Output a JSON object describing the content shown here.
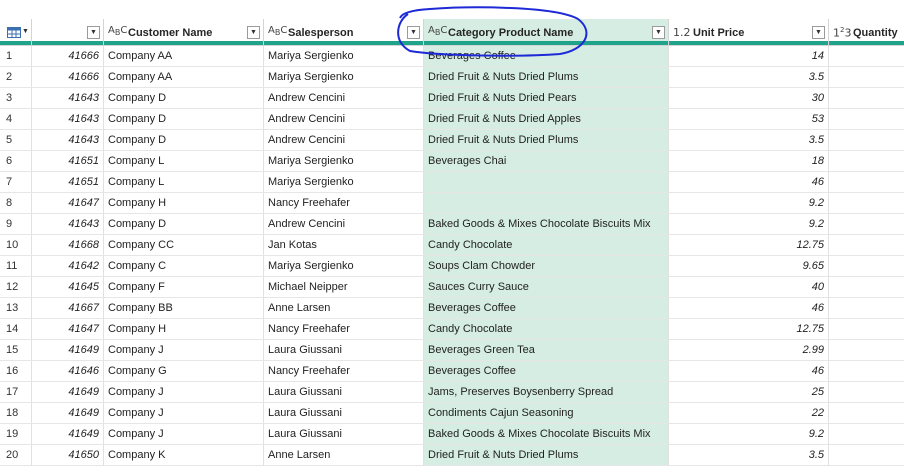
{
  "columns": [
    {
      "key": "c0",
      "type": "",
      "name": ""
    },
    {
      "key": "c1",
      "type": "ABC",
      "name": "Customer Name"
    },
    {
      "key": "c2",
      "type": "ABC",
      "name": "Salesperson"
    },
    {
      "key": "c3",
      "type": "ABC",
      "name": "Category Product Name"
    },
    {
      "key": "c4",
      "type": "1.2",
      "name": "Unit Price"
    },
    {
      "key": "c5",
      "type": "123",
      "name": "Quantity"
    }
  ],
  "rows": [
    {
      "n": "1",
      "id": "41666",
      "customer": "Company AA",
      "sales": "Mariya Sergienko",
      "product": "Beverages Coffee",
      "price": "14"
    },
    {
      "n": "2",
      "id": "41666",
      "customer": "Company AA",
      "sales": "Mariya Sergienko",
      "product": "Dried Fruit & Nuts Dried Plums",
      "price": "3.5"
    },
    {
      "n": "3",
      "id": "41643",
      "customer": "Company D",
      "sales": "Andrew Cencini",
      "product": "Dried Fruit & Nuts Dried Pears",
      "price": "30"
    },
    {
      "n": "4",
      "id": "41643",
      "customer": "Company D",
      "sales": "Andrew Cencini",
      "product": "Dried Fruit & Nuts Dried Apples",
      "price": "53"
    },
    {
      "n": "5",
      "id": "41643",
      "customer": "Company D",
      "sales": "Andrew Cencini",
      "product": "Dried Fruit & Nuts Dried Plums",
      "price": "3.5"
    },
    {
      "n": "6",
      "id": "41651",
      "customer": "Company L",
      "sales": "Mariya Sergienko",
      "product": "Beverages Chai",
      "price": "18"
    },
    {
      "n": "7",
      "id": "41651",
      "customer": "Company L",
      "sales": "Mariya Sergienko",
      "product": "",
      "price": "46"
    },
    {
      "n": "8",
      "id": "41647",
      "customer": "Company H",
      "sales": "Nancy Freehafer",
      "product": "",
      "price": "9.2"
    },
    {
      "n": "9",
      "id": "41643",
      "customer": "Company D",
      "sales": "Andrew Cencini",
      "product": "Baked Goods & Mixes Chocolate Biscuits Mix",
      "price": "9.2"
    },
    {
      "n": "10",
      "id": "41668",
      "customer": "Company CC",
      "sales": "Jan Kotas",
      "product": "Candy Chocolate",
      "price": "12.75"
    },
    {
      "n": "11",
      "id": "41642",
      "customer": "Company C",
      "sales": "Mariya Sergienko",
      "product": "Soups Clam Chowder",
      "price": "9.65"
    },
    {
      "n": "12",
      "id": "41645",
      "customer": "Company F",
      "sales": "Michael Neipper",
      "product": "Sauces Curry Sauce",
      "price": "40"
    },
    {
      "n": "13",
      "id": "41667",
      "customer": "Company BB",
      "sales": "Anne Larsen",
      "product": "Beverages Coffee",
      "price": "46"
    },
    {
      "n": "14",
      "id": "41647",
      "customer": "Company H",
      "sales": "Nancy Freehafer",
      "product": "Candy Chocolate",
      "price": "12.75"
    },
    {
      "n": "15",
      "id": "41649",
      "customer": "Company J",
      "sales": "Laura Giussani",
      "product": "Beverages Green Tea",
      "price": "2.99"
    },
    {
      "n": "16",
      "id": "41646",
      "customer": "Company G",
      "sales": "Nancy Freehafer",
      "product": "Beverages Coffee",
      "price": "46"
    },
    {
      "n": "17",
      "id": "41649",
      "customer": "Company J",
      "sales": "Laura Giussani",
      "product": "Jams, Preserves Boysenberry Spread",
      "price": "25"
    },
    {
      "n": "18",
      "id": "41649",
      "customer": "Company J",
      "sales": "Laura Giussani",
      "product": "Condiments Cajun Seasoning",
      "price": "22"
    },
    {
      "n": "19",
      "id": "41649",
      "customer": "Company J",
      "sales": "Laura Giussani",
      "product": "Baked Goods & Mixes Chocolate Biscuits Mix",
      "price": "9.2"
    },
    {
      "n": "20",
      "id": "41650",
      "customer": "Company K",
      "sales": "Anne Larsen",
      "product": "Dried Fruit & Nuts Dried Plums",
      "price": "3.5"
    }
  ],
  "colors": {
    "accent": "#1fa38a",
    "selected_column": "#d6ede3",
    "annotation": "#1d2ad6"
  },
  "icons": {
    "table_menu": "table-icon",
    "dropdown": "chevron-down-icon"
  }
}
